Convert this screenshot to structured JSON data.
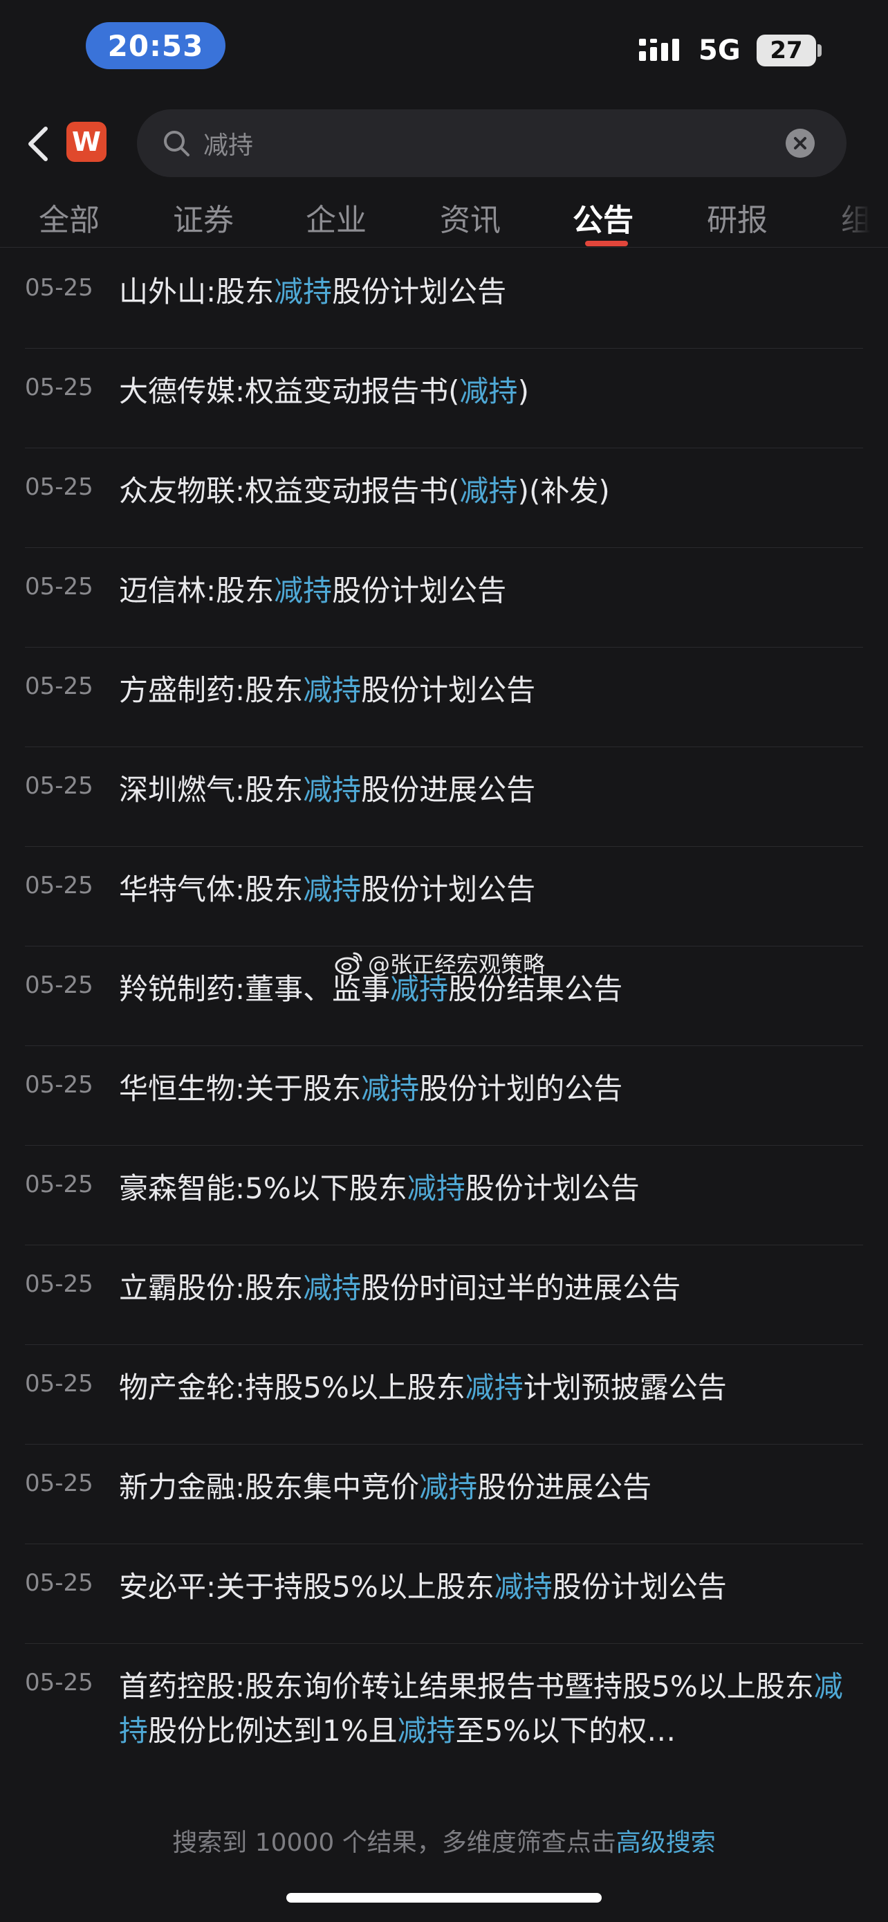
{
  "status_bar": {
    "time": "20:53",
    "network": "5G",
    "battery": "27"
  },
  "header": {
    "app_logo": "W",
    "search": {
      "value": "减持"
    }
  },
  "tabs": [
    {
      "label": "全部",
      "active": false
    },
    {
      "label": "证券",
      "active": false
    },
    {
      "label": "企业",
      "active": false
    },
    {
      "label": "资讯",
      "active": false
    },
    {
      "label": "公告",
      "active": true
    },
    {
      "label": "研报",
      "active": false
    },
    {
      "label": "组",
      "active": false
    }
  ],
  "highlight_color": "#4fa9d6",
  "results": [
    {
      "date": "05-25",
      "segments": [
        {
          "t": "山外山:股东"
        },
        {
          "t": "减持",
          "hl": true
        },
        {
          "t": "股份计划公告"
        }
      ]
    },
    {
      "date": "05-25",
      "segments": [
        {
          "t": "大德传媒:权益变动报告书("
        },
        {
          "t": "减持",
          "hl": true
        },
        {
          "t": ")"
        }
      ]
    },
    {
      "date": "05-25",
      "segments": [
        {
          "t": "众友物联:权益变动报告书("
        },
        {
          "t": "减持",
          "hl": true
        },
        {
          "t": ")(补发)"
        }
      ]
    },
    {
      "date": "05-25",
      "segments": [
        {
          "t": "迈信林:股东"
        },
        {
          "t": "减持",
          "hl": true
        },
        {
          "t": "股份计划公告"
        }
      ]
    },
    {
      "date": "05-25",
      "segments": [
        {
          "t": "方盛制药:股东"
        },
        {
          "t": "减持",
          "hl": true
        },
        {
          "t": "股份计划公告"
        }
      ]
    },
    {
      "date": "05-25",
      "segments": [
        {
          "t": "深圳燃气:股东"
        },
        {
          "t": "减持",
          "hl": true
        },
        {
          "t": "股份进展公告"
        }
      ]
    },
    {
      "date": "05-25",
      "segments": [
        {
          "t": "华特气体:股东"
        },
        {
          "t": "减持",
          "hl": true
        },
        {
          "t": "股份计划公告"
        }
      ]
    },
    {
      "date": "05-25",
      "segments": [
        {
          "t": "羚锐制药:董事、监事"
        },
        {
          "t": "减持",
          "hl": true
        },
        {
          "t": "股份结果公告"
        }
      ]
    },
    {
      "date": "05-25",
      "segments": [
        {
          "t": "华恒生物:关于股东"
        },
        {
          "t": "减持",
          "hl": true
        },
        {
          "t": "股份计划的公告"
        }
      ]
    },
    {
      "date": "05-25",
      "segments": [
        {
          "t": "豪森智能:5%以下股东"
        },
        {
          "t": "减持",
          "hl": true
        },
        {
          "t": "股份计划公告"
        }
      ]
    },
    {
      "date": "05-25",
      "segments": [
        {
          "t": "立霸股份:股东"
        },
        {
          "t": "减持",
          "hl": true
        },
        {
          "t": "股份时间过半的进展公告"
        }
      ]
    },
    {
      "date": "05-25",
      "segments": [
        {
          "t": "物产金轮:持股5%以上股东"
        },
        {
          "t": "减持",
          "hl": true
        },
        {
          "t": "计划预披露公告"
        }
      ]
    },
    {
      "date": "05-25",
      "segments": [
        {
          "t": "新力金融:股东集中竞价"
        },
        {
          "t": "减持",
          "hl": true
        },
        {
          "t": "股份进展公告"
        }
      ]
    },
    {
      "date": "05-25",
      "segments": [
        {
          "t": "安必平:关于持股5%以上股东"
        },
        {
          "t": "减持",
          "hl": true
        },
        {
          "t": "股份计划公告"
        }
      ]
    },
    {
      "date": "05-25",
      "two_line": true,
      "segments": [
        {
          "t": "首药控股:股东询价转让结果报告书暨持股5%以上股东"
        },
        {
          "t": "减持",
          "hl": true
        },
        {
          "t": "股份比例达到1%且"
        },
        {
          "t": "减持",
          "hl": true
        },
        {
          "t": "至5%以下的权…"
        }
      ]
    }
  ],
  "footer": {
    "prefix": "搜索到 10000 个结果，多维度筛查点击",
    "link": "高级搜索"
  },
  "watermark": "@张正经宏观策略"
}
